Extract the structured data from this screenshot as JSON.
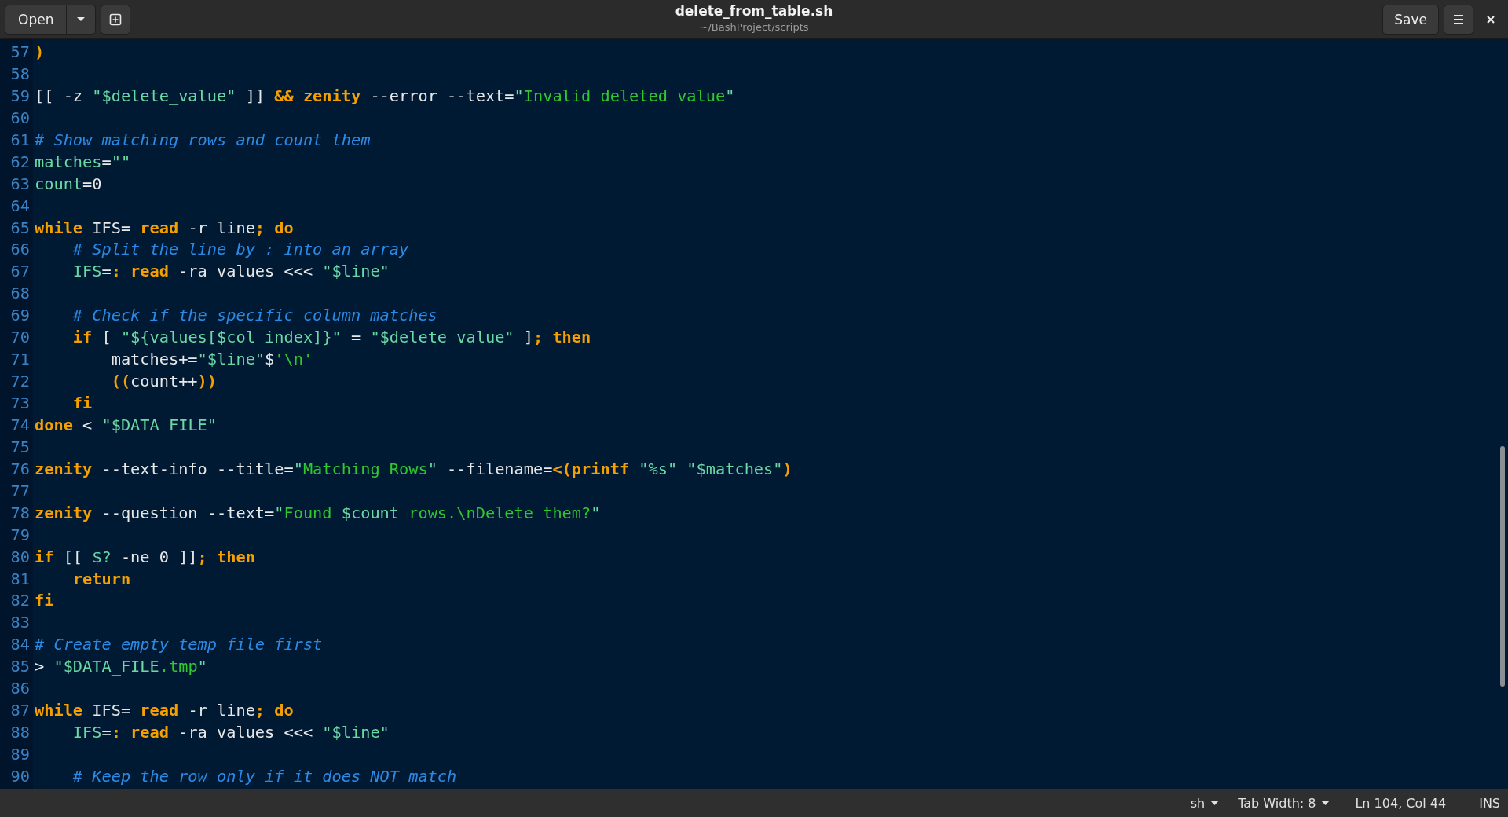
{
  "header": {
    "open_button": "Open",
    "title": "delete_from_table.sh",
    "subtitle": "~/BashProject/scripts",
    "save_button": "Save"
  },
  "lines": [
    {
      "number": "57",
      "tokens": [
        {
          "text": ")",
          "kind": "k"
        }
      ]
    },
    {
      "number": "58"
    },
    {
      "number": "59",
      "tokens": [
        {
          "text": "[[ -z ",
          "kind": "p"
        },
        {
          "text": "\"$delete_value\"",
          "kind": "s"
        },
        {
          "text": " ]] ",
          "kind": "p"
        },
        {
          "text": "&& zenity",
          "kind": "k"
        },
        {
          "text": " --error --text=",
          "kind": "p"
        },
        {
          "text": "\"",
          "kind": "s"
        },
        {
          "text": "Invalid deleted value",
          "kind": "g"
        },
        {
          "text": "\"",
          "kind": "s"
        }
      ]
    },
    {
      "number": "60"
    },
    {
      "number": "61",
      "tokens": [
        {
          "text": "# Show matching rows and count them",
          "kind": "c"
        }
      ]
    },
    {
      "number": "62",
      "tokens": [
        {
          "text": "matches",
          "kind": "s"
        },
        {
          "text": "=",
          "kind": "p"
        },
        {
          "text": "\"\"",
          "kind": "s"
        }
      ]
    },
    {
      "number": "63",
      "tokens": [
        {
          "text": "count",
          "kind": "s"
        },
        {
          "text": "=0",
          "kind": "p"
        }
      ]
    },
    {
      "number": "64"
    },
    {
      "number": "65",
      "tokens": [
        {
          "text": "while",
          "kind": "k"
        },
        {
          "text": " IFS= ",
          "kind": "p"
        },
        {
          "text": "read",
          "kind": "k"
        },
        {
          "text": " -r line",
          "kind": "p"
        },
        {
          "text": "; do",
          "kind": "k"
        }
      ]
    },
    {
      "number": "66",
      "tokens": [
        {
          "text": "    # Split the line by : into an array",
          "kind": "c"
        }
      ]
    },
    {
      "number": "67",
      "tokens": [
        {
          "text": "    IFS",
          "kind": "s"
        },
        {
          "text": "=",
          "kind": "p"
        },
        {
          "text": ": read",
          "kind": "k"
        },
        {
          "text": " -ra values <<< ",
          "kind": "p"
        },
        {
          "text": "\"$line\"",
          "kind": "s"
        }
      ]
    },
    {
      "number": "68"
    },
    {
      "number": "69",
      "tokens": [
        {
          "text": "    # Check if the specific column matches",
          "kind": "c"
        }
      ]
    },
    {
      "number": "70",
      "tokens": [
        {
          "text": "    if",
          "kind": "k"
        },
        {
          "text": " [ ",
          "kind": "p"
        },
        {
          "text": "\"${values[$col_index]}\"",
          "kind": "s"
        },
        {
          "text": " = ",
          "kind": "p"
        },
        {
          "text": "\"$delete_value\"",
          "kind": "s"
        },
        {
          "text": " ]",
          "kind": "p"
        },
        {
          "text": "; then",
          "kind": "k"
        }
      ]
    },
    {
      "number": "71",
      "tokens": [
        {
          "text": "        matches+=",
          "kind": "p"
        },
        {
          "text": "\"$line\"",
          "kind": "s"
        },
        {
          "text": "$",
          "kind": "p"
        },
        {
          "text": "'\\n'",
          "kind": "g"
        }
      ]
    },
    {
      "number": "72",
      "tokens": [
        {
          "text": "        ((",
          "kind": "k"
        },
        {
          "text": "count++",
          "kind": "p"
        },
        {
          "text": "))",
          "kind": "k"
        }
      ]
    },
    {
      "number": "73",
      "tokens": [
        {
          "text": "    fi",
          "kind": "k"
        }
      ]
    },
    {
      "number": "74",
      "tokens": [
        {
          "text": "done",
          "kind": "k"
        },
        {
          "text": " < ",
          "kind": "p"
        },
        {
          "text": "\"$DATA_FILE\"",
          "kind": "s"
        }
      ]
    },
    {
      "number": "75"
    },
    {
      "number": "76",
      "tokens": [
        {
          "text": "zenity",
          "kind": "k"
        },
        {
          "text": " --text-info --title=",
          "kind": "p"
        },
        {
          "text": "\"",
          "kind": "s"
        },
        {
          "text": "Matching Rows",
          "kind": "g"
        },
        {
          "text": "\"",
          "kind": "s"
        },
        {
          "text": " --filename=",
          "kind": "p"
        },
        {
          "text": "<(printf",
          "kind": "k"
        },
        {
          "text": " \"%s\"",
          "kind": "s"
        },
        {
          "text": " \"$matches\"",
          "kind": "s"
        },
        {
          "text": ")",
          "kind": "k"
        }
      ]
    },
    {
      "number": "77"
    },
    {
      "number": "78",
      "tokens": [
        {
          "text": "zenity",
          "kind": "k"
        },
        {
          "text": " --question --text=",
          "kind": "p"
        },
        {
          "text": "\"",
          "kind": "s"
        },
        {
          "text": "Found",
          "kind": "g"
        },
        {
          "text": " $count",
          "kind": "s"
        },
        {
          "text": " rows.\\nDelete them?",
          "kind": "g"
        },
        {
          "text": "\"",
          "kind": "s"
        }
      ]
    },
    {
      "number": "79"
    },
    {
      "number": "80",
      "tokens": [
        {
          "text": "if",
          "kind": "k"
        },
        {
          "text": " [[ ",
          "kind": "p"
        },
        {
          "text": "$?",
          "kind": "s"
        },
        {
          "text": " -ne 0 ]]",
          "kind": "p"
        },
        {
          "text": "; then",
          "kind": "k"
        }
      ]
    },
    {
      "number": "81",
      "tokens": [
        {
          "text": "    return",
          "kind": "k"
        }
      ]
    },
    {
      "number": "82",
      "tokens": [
        {
          "text": "fi",
          "kind": "k"
        }
      ]
    },
    {
      "number": "83"
    },
    {
      "number": "84",
      "tokens": [
        {
          "text": "# Create empty temp file first",
          "kind": "c"
        }
      ]
    },
    {
      "number": "85",
      "tokens": [
        {
          "text": "> ",
          "kind": "p"
        },
        {
          "text": "\"$DATA_FILE",
          "kind": "s"
        },
        {
          "text": ".tmp",
          "kind": "g"
        },
        {
          "text": "\"",
          "kind": "s"
        }
      ]
    },
    {
      "number": "86"
    },
    {
      "number": "87",
      "tokens": [
        {
          "text": "while",
          "kind": "k"
        },
        {
          "text": " IFS= ",
          "kind": "p"
        },
        {
          "text": "read",
          "kind": "k"
        },
        {
          "text": " -r line",
          "kind": "p"
        },
        {
          "text": "; do",
          "kind": "k"
        }
      ]
    },
    {
      "number": "88",
      "tokens": [
        {
          "text": "    IFS",
          "kind": "s"
        },
        {
          "text": "=",
          "kind": "p"
        },
        {
          "text": ": read",
          "kind": "k"
        },
        {
          "text": " -ra values <<< ",
          "kind": "p"
        },
        {
          "text": "\"$line\"",
          "kind": "s"
        }
      ]
    },
    {
      "number": "89"
    },
    {
      "number": "90",
      "tokens": [
        {
          "text": "    # Keep the row only if it does NOT match",
          "kind": "c"
        }
      ]
    }
  ],
  "status_bar": {
    "language": "sh",
    "tab_width": "Tab Width: 8",
    "position": "Ln 104, Col 44",
    "mode": "INS"
  }
}
